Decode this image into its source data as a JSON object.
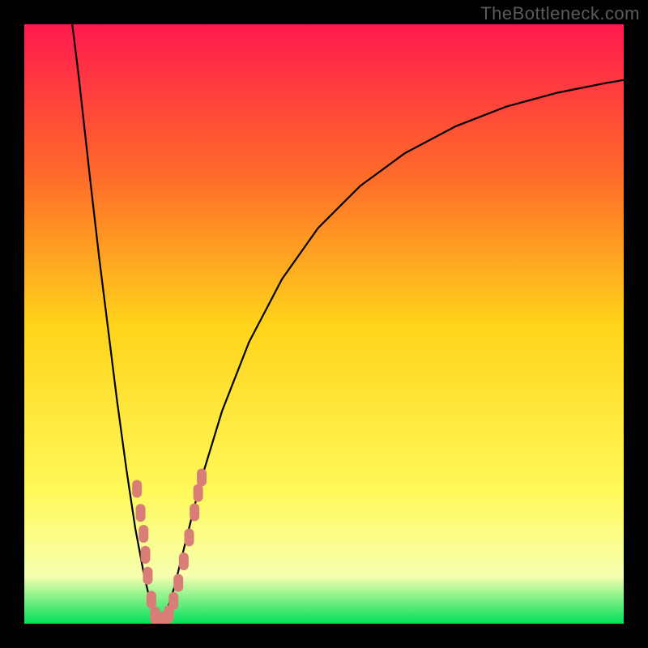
{
  "watermark": "TheBottleneck.com",
  "chart_data": {
    "type": "line",
    "title": "",
    "xlabel": "",
    "ylabel": "",
    "xlim": [
      0,
      100
    ],
    "ylim": [
      0,
      100
    ],
    "gradient_colors": {
      "top": "#ff1a4f",
      "upper_mid": "#ff6a2a",
      "mid": "#ffd31a",
      "lower_mid": "#fff95a",
      "pale": "#f7ffb0",
      "bottom": "#00e05a"
    },
    "series": [
      {
        "name": "bottleneck-curve",
        "mode": "line",
        "points": [
          {
            "x": 8.0,
            "y": 100.0
          },
          {
            "x": 9.0,
            "y": 92.0
          },
          {
            "x": 10.0,
            "y": 83.0
          },
          {
            "x": 11.0,
            "y": 74.0
          },
          {
            "x": 12.5,
            "y": 61.0
          },
          {
            "x": 14.0,
            "y": 49.0
          },
          {
            "x": 15.5,
            "y": 37.0
          },
          {
            "x": 17.0,
            "y": 26.0
          },
          {
            "x": 18.5,
            "y": 16.0
          },
          {
            "x": 20.0,
            "y": 8.0
          },
          {
            "x": 21.3,
            "y": 2.5
          },
          {
            "x": 22.3,
            "y": 0.3
          },
          {
            "x": 23.5,
            "y": 1.2
          },
          {
            "x": 25.0,
            "y": 6.0
          },
          {
            "x": 27.0,
            "y": 14.0
          },
          {
            "x": 29.5,
            "y": 24.0
          },
          {
            "x": 33.0,
            "y": 35.5
          },
          {
            "x": 37.5,
            "y": 47.0
          },
          {
            "x": 43.0,
            "y": 57.5
          },
          {
            "x": 49.0,
            "y": 66.0
          },
          {
            "x": 56.0,
            "y": 73.0
          },
          {
            "x": 63.5,
            "y": 78.5
          },
          {
            "x": 72.0,
            "y": 83.0
          },
          {
            "x": 80.5,
            "y": 86.3
          },
          {
            "x": 89.0,
            "y": 88.6
          },
          {
            "x": 97.0,
            "y": 90.2
          },
          {
            "x": 100.0,
            "y": 90.7
          }
        ]
      },
      {
        "name": "measured-markers",
        "mode": "markers",
        "marker_color": "#d97d77",
        "points": [
          {
            "x": 18.8,
            "y": 22.5
          },
          {
            "x": 19.4,
            "y": 18.5
          },
          {
            "x": 19.9,
            "y": 15.0
          },
          {
            "x": 20.2,
            "y": 11.5
          },
          {
            "x": 20.6,
            "y": 8.0
          },
          {
            "x": 21.2,
            "y": 4.0
          },
          {
            "x": 21.8,
            "y": 1.4
          },
          {
            "x": 22.5,
            "y": 0.4
          },
          {
            "x": 23.3,
            "y": 0.6
          },
          {
            "x": 24.1,
            "y": 1.6
          },
          {
            "x": 24.9,
            "y": 3.8
          },
          {
            "x": 25.7,
            "y": 6.8
          },
          {
            "x": 26.6,
            "y": 10.4
          },
          {
            "x": 27.5,
            "y": 14.4
          },
          {
            "x": 28.4,
            "y": 18.6
          },
          {
            "x": 29.0,
            "y": 21.8
          },
          {
            "x": 29.6,
            "y": 24.4
          }
        ]
      }
    ]
  }
}
